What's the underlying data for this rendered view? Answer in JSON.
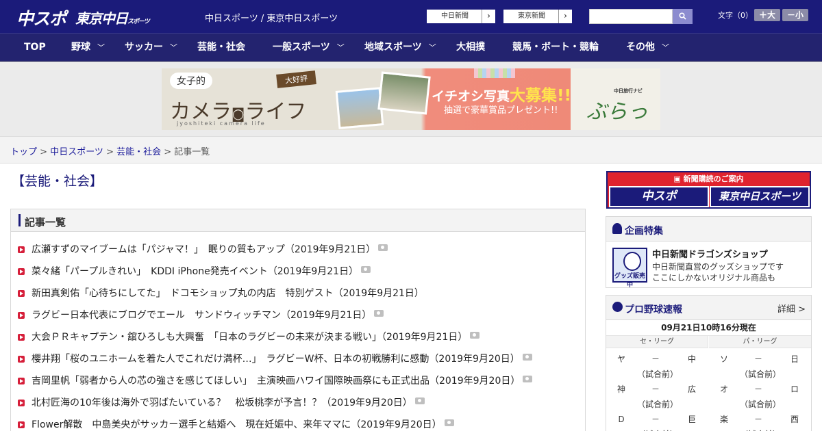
{
  "header": {
    "logo_main": "中スポ",
    "logo_tokyo": "東京中日",
    "logo_tokyo_suffix": "スポーツ",
    "site_title": "中日スポーツ / 東京中日スポーツ",
    "paper_buttons": [
      "中日新聞",
      "東京新聞"
    ],
    "search_placeholder": "",
    "font_size_label": "文字（0）",
    "font_plus": "＋大",
    "font_minus": "－小"
  },
  "nav": [
    {
      "label": "TOP",
      "has_menu": false
    },
    {
      "label": "野球",
      "has_menu": true
    },
    {
      "label": "サッカー",
      "has_menu": true
    },
    {
      "label": "芸能・社会",
      "has_menu": false
    },
    {
      "label": "一般スポーツ",
      "has_menu": true
    },
    {
      "label": "地域スポーツ",
      "has_menu": true
    },
    {
      "label": "大相撲",
      "has_menu": false
    },
    {
      "label": "競馬・ボート・競輪",
      "has_menu": false
    },
    {
      "label": "その他",
      "has_menu": true
    }
  ],
  "banner": {
    "joshi": "女子的",
    "camera_life": "カメラ",
    "camera_life2": "ライフ",
    "sub": "jyoshiteki camera life",
    "daikohyo": "大好評",
    "ichioshi": "イチオシ写真",
    "boshu": "大募集!!",
    "present": "抽選で豪華賞品プレゼント!!",
    "nabi": "中日旅行ナビ",
    "burat": "ぶらっ人"
  },
  "breadcrumb": {
    "items": [
      "トップ",
      "中日スポーツ",
      "芸能・社会"
    ],
    "current": "記事一覧",
    "sep": " > "
  },
  "page_heading": "【芸能・社会】",
  "list": {
    "title": "記事一覧",
    "articles": [
      {
        "text": "広瀬すずのマイブームは「パジャマ！」　眠りの質もアップ（2019年9月21日）",
        "photo": true
      },
      {
        "text": "菜々緒「パープルきれい」　KDDI iPhone発売イベント（2019年9月21日）",
        "photo": true
      },
      {
        "text": "新田真剣佑「心待ちにしてた」　ドコモショップ丸の内店　特別ゲスト（2019年9月21日）",
        "photo": false
      },
      {
        "text": "ラグビー日本代表にブログでエール　サンドウィッチマン（2019年9月21日）",
        "photo": true
      },
      {
        "text": "大会ＰＲキャプテン・舘ひろしも大興奮　「日本のラグビーの未来が決まる戦い」（2019年9月21日）",
        "photo": true
      },
      {
        "text": "櫻井翔「桜のユニホームを着た人でこれだけ満杯…」　ラグビーW杯、日本の初戦勝利に感動（2019年9月20日）",
        "photo": true
      },
      {
        "text": "吉岡里帆「弱者から人の芯の強さを感じてほしい」　主演映画ハワイ国際映画祭にも正式出品（2019年9月20日）",
        "photo": true
      },
      {
        "text": "北村匠海の10年後は海外で羽ばたいている？　松坂桃李が予言！？（2019年9月20日）",
        "photo": true
      },
      {
        "text": "Flower解散　中島美央がサッカー選手と結婚へ　現在妊娠中、来年ママに（2019年9月20日）",
        "photo": true
      }
    ]
  },
  "sidebar": {
    "subscribe": {
      "caption": "新聞購読のご案内",
      "b1": "中スポ",
      "b2": "東京中日スポーツ"
    },
    "feature": {
      "title": "企画特集",
      "shop_img_label": "グッズ販売中",
      "shop_title": "中日新聞ドラゴンズショップ",
      "shop_desc1": "中日新聞直営のグッズショップです",
      "shop_desc2": "ここにしかないオリジナル商品も"
    },
    "scores": {
      "title": "プロ野球速報",
      "more": "詳細 >",
      "time": "09月21日10時16分現在",
      "central": "セ・リーグ",
      "pacific": "パ・リーグ",
      "status": "（試合前）",
      "dash": "－",
      "central_games": [
        [
          "ヤ",
          "中"
        ],
        [
          "神",
          "広"
        ],
        [
          "Ｄ",
          "巨"
        ]
      ],
      "pacific_games": [
        [
          "ソ",
          "日"
        ],
        [
          "オ",
          "ロ"
        ],
        [
          "楽",
          "西"
        ]
      ]
    }
  }
}
